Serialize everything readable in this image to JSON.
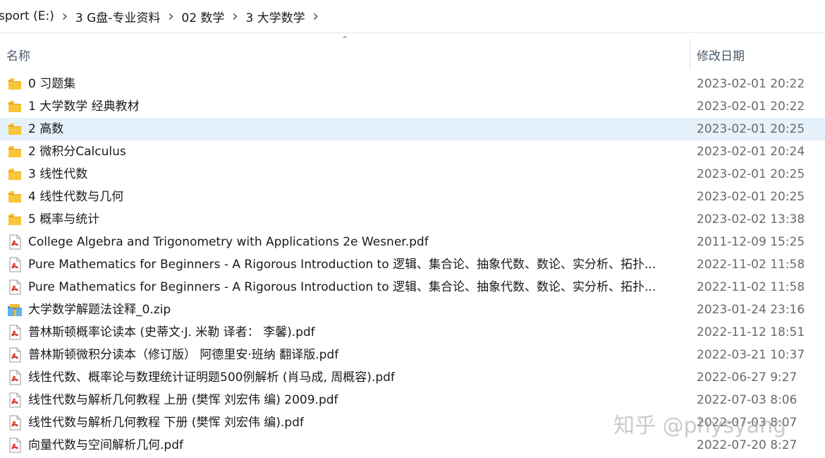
{
  "breadcrumb": [
    {
      "label": "sport (E:)"
    },
    {
      "label": "3 G盘-专业资料"
    },
    {
      "label": "02 数学"
    },
    {
      "label": "3 大学数学"
    }
  ],
  "columns": {
    "name": "名称",
    "date": "修改日期"
  },
  "files": [
    {
      "name": "0 习题集",
      "date": "2023-02-01 20:22",
      "type": "folder",
      "selected": false
    },
    {
      "name": "1 大学数学 经典教材",
      "date": "2023-02-01 20:22",
      "type": "folder",
      "selected": false
    },
    {
      "name": "2 高数",
      "date": "2023-02-01 20:25",
      "type": "folder",
      "selected": true
    },
    {
      "name": "2 微积分Calculus",
      "date": "2023-02-01 20:24",
      "type": "folder",
      "selected": false
    },
    {
      "name": "3 线性代数",
      "date": "2023-02-01 20:25",
      "type": "folder",
      "selected": false
    },
    {
      "name": "4 线性代数与几何",
      "date": "2023-02-01 20:25",
      "type": "folder",
      "selected": false
    },
    {
      "name": "5 概率与统计",
      "date": "2023-02-02 13:38",
      "type": "folder",
      "selected": false
    },
    {
      "name": "College Algebra and Trigonometry with Applications 2e Wesner.pdf",
      "date": "2011-12-09 15:25",
      "type": "pdf",
      "selected": false
    },
    {
      "name": "Pure Mathematics for Beginners - A Rigorous Introduction to 逻辑、集合论、抽象代数、数论、实分析、拓扑...",
      "date": "2022-11-02 11:58",
      "type": "pdf",
      "selected": false
    },
    {
      "name": "Pure Mathematics for Beginners - A Rigorous Introduction to 逻辑、集合论、抽象代数、数论、实分析、拓扑...",
      "date": "2022-11-02 11:58",
      "type": "pdf",
      "selected": false
    },
    {
      "name": "大学数学解题法诠释_0.zip",
      "date": "2023-01-24 23:16",
      "type": "zip",
      "selected": false
    },
    {
      "name": "普林斯顿概率论读本 (史蒂文·J. 米勒 译者： 李馨).pdf",
      "date": "2022-11-12 18:51",
      "type": "pdf",
      "selected": false
    },
    {
      "name": "普林斯顿微积分读本（修订版） 阿德里安·班纳 翻译版.pdf",
      "date": "2022-03-21 10:37",
      "type": "pdf",
      "selected": false
    },
    {
      "name": "线性代数、概率论与数理统计证明题500例解析 (肖马成, 周概容).pdf",
      "date": "2022-06-27 9:27",
      "type": "pdf",
      "selected": false
    },
    {
      "name": "线性代数与解析几何教程 上册 (樊恽 刘宏伟 编) 2009.pdf",
      "date": "2022-07-03 8:06",
      "type": "pdf",
      "selected": false
    },
    {
      "name": "线性代数与解析几何教程 下册 (樊恽 刘宏伟 编).pdf",
      "date": "2022-07-03 8:07",
      "type": "pdf",
      "selected": false
    },
    {
      "name": "向量代数与空间解析几何.pdf",
      "date": "2022-07-20 8:27",
      "type": "pdf",
      "selected": false
    }
  ],
  "watermark": "知乎 @physyang",
  "colors": {
    "selected_row": "#e5f1fb",
    "folder": "#f8c63b",
    "pdf_red": "#d63a2f"
  },
  "icons": {
    "folder": "folder-icon",
    "pdf": "pdf-file-icon",
    "zip": "zip-archive-icon",
    "separator": "chevron-right-icon",
    "sort": "sort-ascending-icon"
  }
}
